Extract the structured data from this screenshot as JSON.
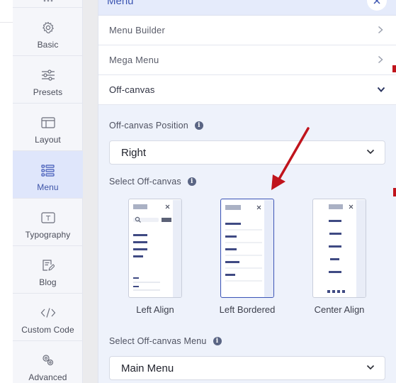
{
  "sidebar": {
    "items": [
      {
        "label": "Basic",
        "icon": "gear-icon"
      },
      {
        "label": "Presets",
        "icon": "sliders-icon"
      },
      {
        "label": "Layout",
        "icon": "layout-icon"
      },
      {
        "label": "Menu",
        "icon": "menu-list-icon",
        "active": true
      },
      {
        "label": "Typography",
        "icon": "typography-icon"
      },
      {
        "label": "Blog",
        "icon": "blog-edit-icon"
      },
      {
        "label": "Custom Code",
        "icon": "code-icon"
      },
      {
        "label": "Advanced",
        "icon": "advanced-gears-icon"
      }
    ]
  },
  "panel": {
    "title": "Menu",
    "accordion": [
      {
        "label": "Menu Builder",
        "state": "collapsed"
      },
      {
        "label": "Mega Menu",
        "state": "collapsed"
      },
      {
        "label": "Off-canvas",
        "state": "expanded"
      }
    ],
    "position": {
      "label": "Off-canvas Position",
      "value": "Right"
    },
    "select_offcanvas": {
      "label": "Select Off-canvas",
      "options": [
        {
          "label": "Left Align",
          "selected": false
        },
        {
          "label": "Left Bordered",
          "selected": true
        },
        {
          "label": "Center Align",
          "selected": false
        }
      ]
    },
    "offcanvas_menu": {
      "label": "Select Off-canvas Menu",
      "value": "Main Menu"
    }
  },
  "colors": {
    "accent": "#3e56b6",
    "active_bg": "#dfe6fb",
    "annotation_arrow": "#c0141c"
  }
}
